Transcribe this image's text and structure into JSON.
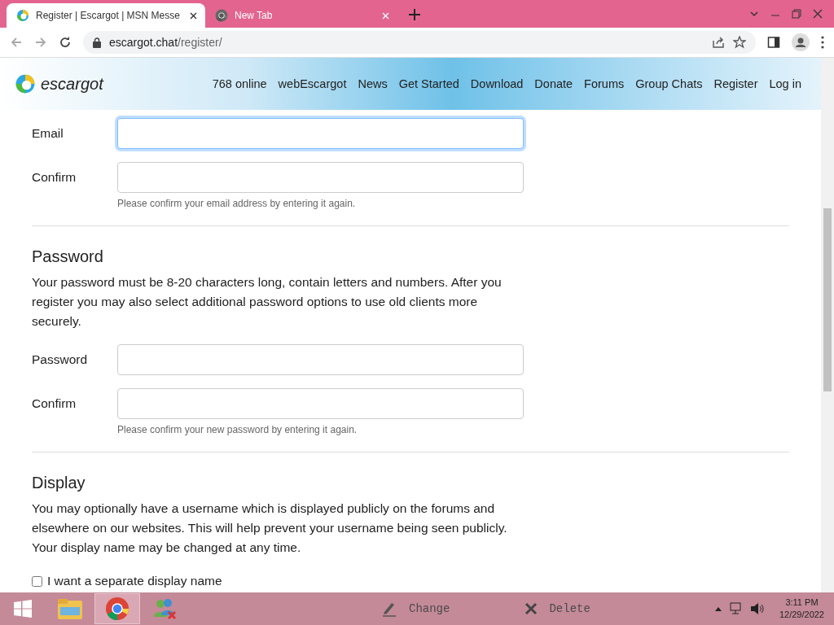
{
  "browser": {
    "tabs": [
      {
        "title": "Register | Escargot | MSN Messe",
        "selected": true
      },
      {
        "title": "New Tab",
        "selected": false
      }
    ],
    "address": {
      "host": "escargot.chat",
      "path": "/register/"
    }
  },
  "site": {
    "logo": "escargot",
    "nav": [
      "768 online",
      "webEscargot",
      "News",
      "Get Started",
      "Download",
      "Donate",
      "Forums",
      "Group Chats",
      "Register",
      "Log in"
    ]
  },
  "form": {
    "email_fields": [
      {
        "label": "Email",
        "focused": true
      },
      {
        "label": "Confirm",
        "focused": false
      }
    ],
    "email_hint": "Please confirm your email address by entering it again.",
    "password": {
      "heading": "Password",
      "text": "Your password must be 8-20 characters long, contain letters and numbers. After you register you may also select additional password options to use old clients more securely.",
      "fields": [
        {
          "label": "Password",
          "focused": false
        },
        {
          "label": "Confirm",
          "focused": false
        }
      ],
      "hint": "Please confirm your new password by entering it again."
    },
    "display": {
      "heading": "Display",
      "text": "You may optionally have a username which is displayed publicly on the forums and elsewhere on our websites. This will help prevent your username being seen publicly. Your display name may be changed at any time.",
      "checkbox": {
        "label": "I want a separate display name",
        "checked": false
      }
    }
  },
  "taskbar": {
    "apps": [
      {
        "kind": "start",
        "selected": false
      },
      {
        "kind": "explorer",
        "selected": false
      },
      {
        "kind": "chrome",
        "selected": true
      },
      {
        "kind": "messenger",
        "selected": false
      }
    ],
    "actions": [
      {
        "kind": "change",
        "label": "Change"
      },
      {
        "kind": "delete",
        "label": "Delete"
      }
    ],
    "time": "3:11 PM",
    "date": "12/29/2022"
  }
}
